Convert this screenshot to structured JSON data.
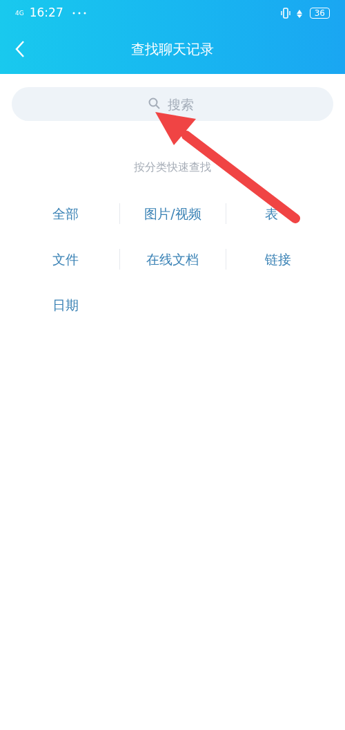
{
  "status_bar": {
    "network": "4G",
    "time": "16:27",
    "battery": "36"
  },
  "header": {
    "title": "查找聊天记录"
  },
  "search": {
    "placeholder": "搜索"
  },
  "section_title": "按分类快速查找",
  "categories": [
    "全部",
    "图片/视频",
    "表",
    "文件",
    "在线文档",
    "链接",
    "日期"
  ]
}
